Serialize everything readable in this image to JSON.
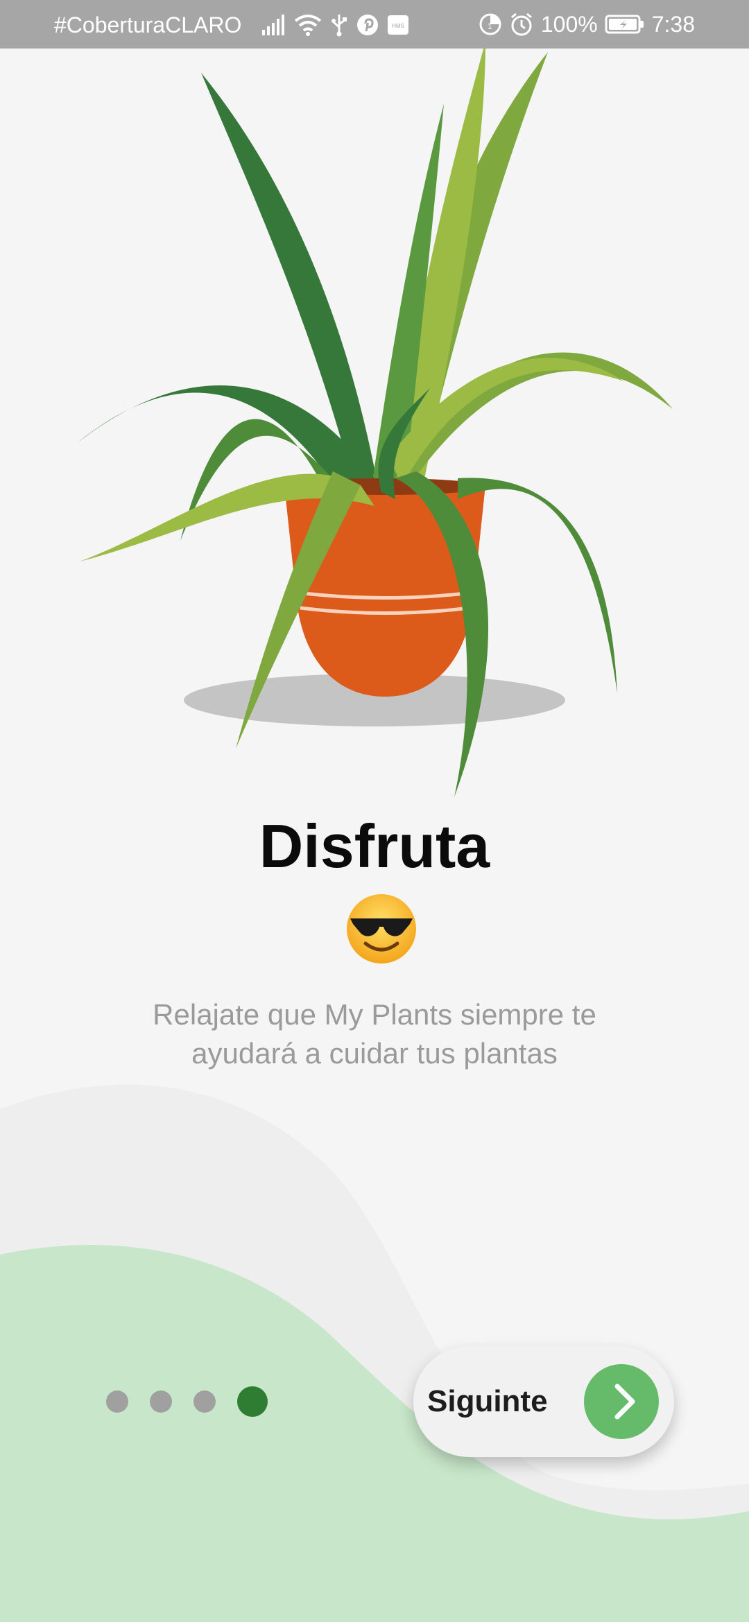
{
  "status_bar": {
    "carrier": "#CoberturaCLARO",
    "battery_percent": "100%",
    "time": "7:38",
    "left_icons": [
      "signal-icon",
      "wifi-icon",
      "usb-icon",
      "pinterest-icon",
      "hms-icon"
    ],
    "right_icons": [
      "data-saver-icon",
      "alarm-icon",
      "battery-icon"
    ]
  },
  "onboarding": {
    "title": "Disfruta",
    "emoji_icon": "sunglasses-smiley-emoji",
    "description": "Relajate que My Plants siempre te ayudará a cuidar tus plantas",
    "illustration": "potted-plant-illustration"
  },
  "pager": {
    "total_pages": 4,
    "current_page": 4
  },
  "next_button": {
    "label": "Siguinte",
    "icon": "chevron-right-icon"
  },
  "colors": {
    "status_bar_bg": "#a6a6a6",
    "background": "#f5f5f5",
    "wave_light": "#efefef",
    "wave_green": "#c8e6c9",
    "dot_inactive": "#a0a0a0",
    "dot_active": "#2e7d32",
    "button_bg": "#f1f1f1",
    "button_circle": "#66bb6a",
    "pot_orange": "#dc5a1a",
    "leaf_dark": "#35783a",
    "leaf_mid": "#4f8c3a",
    "leaf_light": "#9bbb45"
  }
}
